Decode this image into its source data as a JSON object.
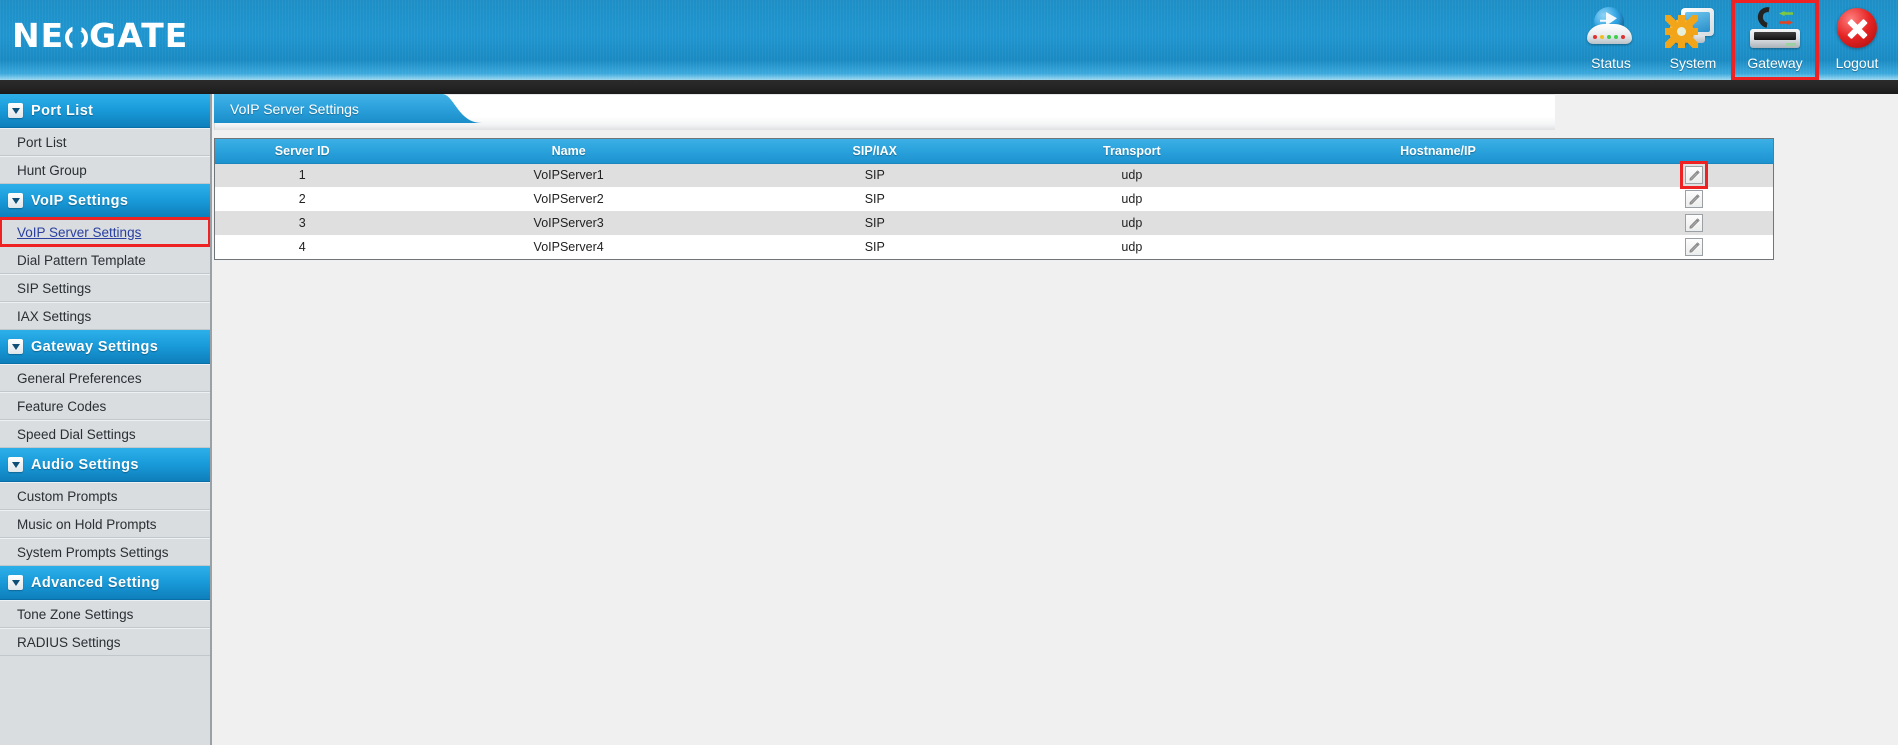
{
  "brand": {
    "name": "NEOGATE"
  },
  "topnav": {
    "items": [
      {
        "label": "Status",
        "icon": "status-globe-icon",
        "selected": false
      },
      {
        "label": "System",
        "icon": "system-monitor-gear-icon",
        "selected": false
      },
      {
        "label": "Gateway",
        "icon": "gateway-device-icon",
        "selected": true
      },
      {
        "label": "Logout",
        "icon": "logout-close-icon",
        "selected": false
      }
    ],
    "highlight_color": "#ee2222"
  },
  "sidebar": {
    "groups": [
      {
        "title": "Port List",
        "caret_icon": "chevron-down-icon",
        "items": [
          {
            "label": "Port List",
            "active": false,
            "boxed": false
          },
          {
            "label": "Hunt Group",
            "active": false,
            "boxed": false
          }
        ]
      },
      {
        "title": "VoIP Settings",
        "caret_icon": "chevron-down-icon",
        "items": [
          {
            "label": "VoIP Server Settings",
            "active": true,
            "boxed": true
          },
          {
            "label": "Dial Pattern Template",
            "active": false,
            "boxed": false
          },
          {
            "label": "SIP Settings",
            "active": false,
            "boxed": false
          },
          {
            "label": "IAX Settings",
            "active": false,
            "boxed": false
          }
        ]
      },
      {
        "title": "Gateway Settings",
        "caret_icon": "chevron-down-icon",
        "items": [
          {
            "label": "General Preferences",
            "active": false,
            "boxed": false
          },
          {
            "label": "Feature Codes",
            "active": false,
            "boxed": false
          },
          {
            "label": "Speed Dial Settings",
            "active": false,
            "boxed": false
          }
        ]
      },
      {
        "title": "Audio Settings",
        "caret_icon": "chevron-down-icon",
        "items": [
          {
            "label": "Custom Prompts",
            "active": false,
            "boxed": false
          },
          {
            "label": "Music on Hold Prompts",
            "active": false,
            "boxed": false
          },
          {
            "label": "System Prompts Settings",
            "active": false,
            "boxed": false
          }
        ]
      },
      {
        "title": "Advanced Setting",
        "caret_icon": "chevron-down-icon",
        "items": [
          {
            "label": "Tone Zone Settings",
            "active": false,
            "boxed": false
          },
          {
            "label": "RADIUS Settings",
            "active": false,
            "boxed": false
          }
        ]
      }
    ]
  },
  "content": {
    "tab_label": "VoIP Server Settings",
    "table": {
      "columns": [
        "Server ID",
        "Name",
        "SIP/IAX",
        "Transport",
        "Hostname/IP",
        ""
      ],
      "rows": [
        {
          "server_id": "1",
          "name": "VoIPServer1",
          "sip_iax": "SIP",
          "transport": "udp",
          "hostname_ip": "",
          "edit_icon": "pencil-edit-icon",
          "edit_boxed": true
        },
        {
          "server_id": "2",
          "name": "VoIPServer2",
          "sip_iax": "SIP",
          "transport": "udp",
          "hostname_ip": "",
          "edit_icon": "pencil-edit-icon",
          "edit_boxed": false
        },
        {
          "server_id": "3",
          "name": "VoIPServer3",
          "sip_iax": "SIP",
          "transport": "udp",
          "hostname_ip": "",
          "edit_icon": "pencil-edit-icon",
          "edit_boxed": false
        },
        {
          "server_id": "4",
          "name": "VoIPServer4",
          "sip_iax": "SIP",
          "transport": "udp",
          "hostname_ip": "",
          "edit_icon": "pencil-edit-icon",
          "edit_boxed": false
        }
      ]
    }
  },
  "colors": {
    "header_blue": "#1f95cf",
    "section_blue": "#1a9cdb",
    "table_header_blue": "#2aa2dc",
    "highlight_red": "#ee2222",
    "row_odd": "#dfdfdf",
    "row_even": "#ffffff",
    "sidebar_bg": "#d9dde0"
  }
}
